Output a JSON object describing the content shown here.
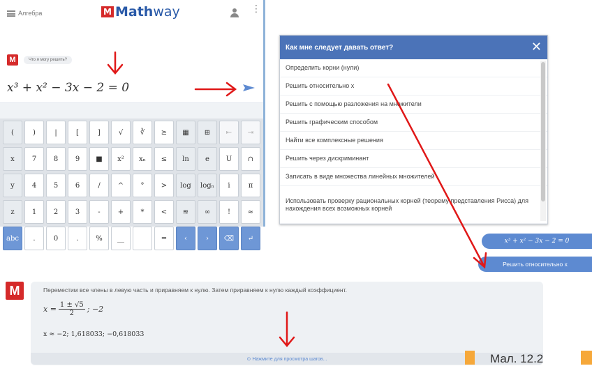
{
  "topbar": {
    "menu_label": "Алгебра",
    "logo_m": "M",
    "logo_math": "Math",
    "logo_way": "way"
  },
  "chat": {
    "badge": "M",
    "hint": "Что я могу решить?"
  },
  "input": {
    "equation": "x³ + x² − 3x − 2 = 0"
  },
  "keypad": {
    "rows": [
      [
        "(",
        ")",
        "|",
        "[",
        "]",
        "√",
        "∛",
        "≥",
        "▦",
        "⊞",
        "⇤",
        "⇥"
      ],
      [
        "x",
        "7",
        "8",
        "9",
        "■",
        "x²",
        "xₙ",
        "≤",
        "ln",
        "e",
        "U",
        "∩"
      ],
      [
        "y",
        "4",
        "5",
        "6",
        "/",
        "^",
        "°",
        ">",
        "log",
        "logₙ",
        "i",
        "π"
      ],
      [
        "z",
        "1",
        "2",
        "3",
        "-",
        "+",
        "*",
        "<",
        "≋",
        "∞",
        "!",
        "≈"
      ],
      [
        "abc",
        ".",
        "0",
        ".",
        "%",
        "__",
        "",
        "=",
        "‹",
        "›",
        "⌫",
        "↵"
      ]
    ]
  },
  "dropdown": {
    "title": "Как мне следует давать ответ?",
    "close": "✕",
    "items": [
      "Определить корни (нули)",
      "Решить относительно x",
      "Решить с помощью разложения на множители",
      "Решить графическим способом",
      "Найти все комплексные решения",
      "Решить через дискриминант",
      "Записать в виде множества линейных множителей",
      "Использовать проверку рациональных корней (теорему представления Рисса) для нахождения всех возможных корней"
    ]
  },
  "solution": {
    "equation": "x³ + x² − 3x − 2 = 0",
    "command": "Решить относительно x"
  },
  "answer": {
    "badge": "M",
    "text": "Переместим все члены в левую часть и приравняем к нулю. Затем приравняем к нулю каждый коэффициент.",
    "x_label": "x =",
    "numerator": "1 ± √5",
    "denominator": "2",
    "x_rest": "; −2",
    "approx": "x ≈ −2; 1,618033; −0,618033",
    "footer": "⊙ Нажмите для просмотра шагов..."
  },
  "caption": {
    "text": "Мал. 12.2"
  },
  "colors": {
    "accent": "#4b73b8",
    "arrow": "#e01818",
    "orange": "#f6a83a",
    "logo_red": "#d52a2a"
  }
}
